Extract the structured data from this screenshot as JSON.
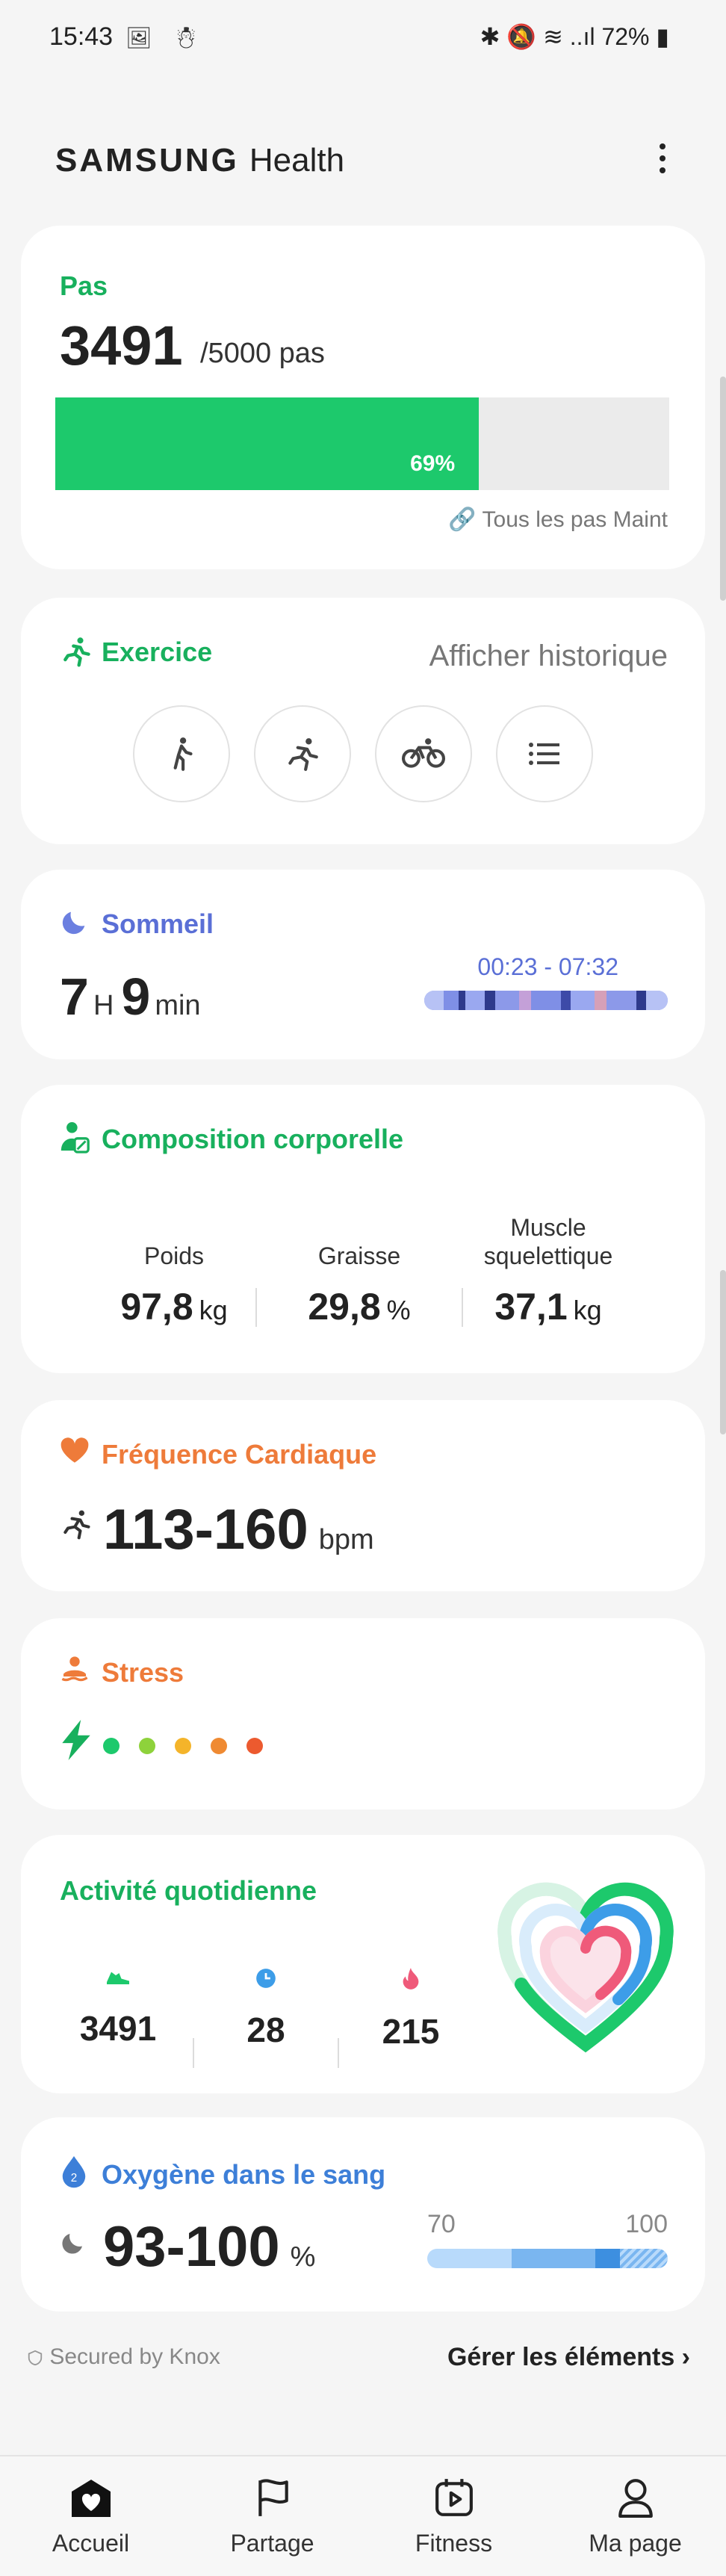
{
  "status_bar": {
    "time": "15:43",
    "left_icons": "🖼 ☃",
    "right_icons": "✱ 🔕 ≋ ..ıl 72% ▮"
  },
  "app": {
    "brand_samsung": "SAMSUNG",
    "brand_health": "Health"
  },
  "steps": {
    "title": "Pas",
    "value": "3491",
    "goal": "/5000 pas",
    "percent_label": "69%",
    "progress_fraction": 0.69,
    "link": "🔗 Tous les pas Maint"
  },
  "exercise": {
    "title": "Exercice",
    "history": "Afficher historique"
  },
  "sleep": {
    "title": "Sommeil",
    "hours": "7",
    "hours_unit": "H",
    "minutes": "9",
    "minutes_unit": "min",
    "range": "00:23 - 07:32"
  },
  "body_composition": {
    "title": "Composition corporelle",
    "metrics": [
      {
        "label": "Poids",
        "value": "97,8",
        "unit": "kg"
      },
      {
        "label": "Graisse",
        "value": "29,8",
        "unit": "%"
      },
      {
        "label": "Muscle squelettique",
        "value": "37,1",
        "unit": "kg"
      }
    ]
  },
  "heart_rate": {
    "title": "Fréquence Cardiaque",
    "value": "113-160",
    "unit": "bpm"
  },
  "stress": {
    "title": "Stress",
    "dot_colors": [
      "#1dc96c",
      "#8ed23b",
      "#f4b42a",
      "#ef8a32",
      "#ec5a2f"
    ]
  },
  "daily_activity": {
    "title": "Activité quotidienne",
    "metrics": [
      {
        "value": "3491",
        "icon": "shoe-icon",
        "color": "#1dc96c"
      },
      {
        "value": "28",
        "icon": "clock-icon",
        "color": "#3d9de8"
      },
      {
        "value": "215",
        "icon": "flame-icon",
        "color": "#ef5a7a"
      }
    ]
  },
  "blood_oxygen": {
    "title": "Oxygène dans le sang",
    "value": "93-100",
    "unit": "%",
    "range_min": "70",
    "range_max": "100"
  },
  "footer": {
    "knox": "Secured by Knox",
    "manage": "Gérer les éléments ›"
  },
  "nav": [
    {
      "label": "Accueil",
      "icon": "home-icon"
    },
    {
      "label": "Partage",
      "icon": "flag-icon"
    },
    {
      "label": "Fitness",
      "icon": "play-icon"
    },
    {
      "label": "Ma page",
      "icon": "person-icon"
    }
  ]
}
